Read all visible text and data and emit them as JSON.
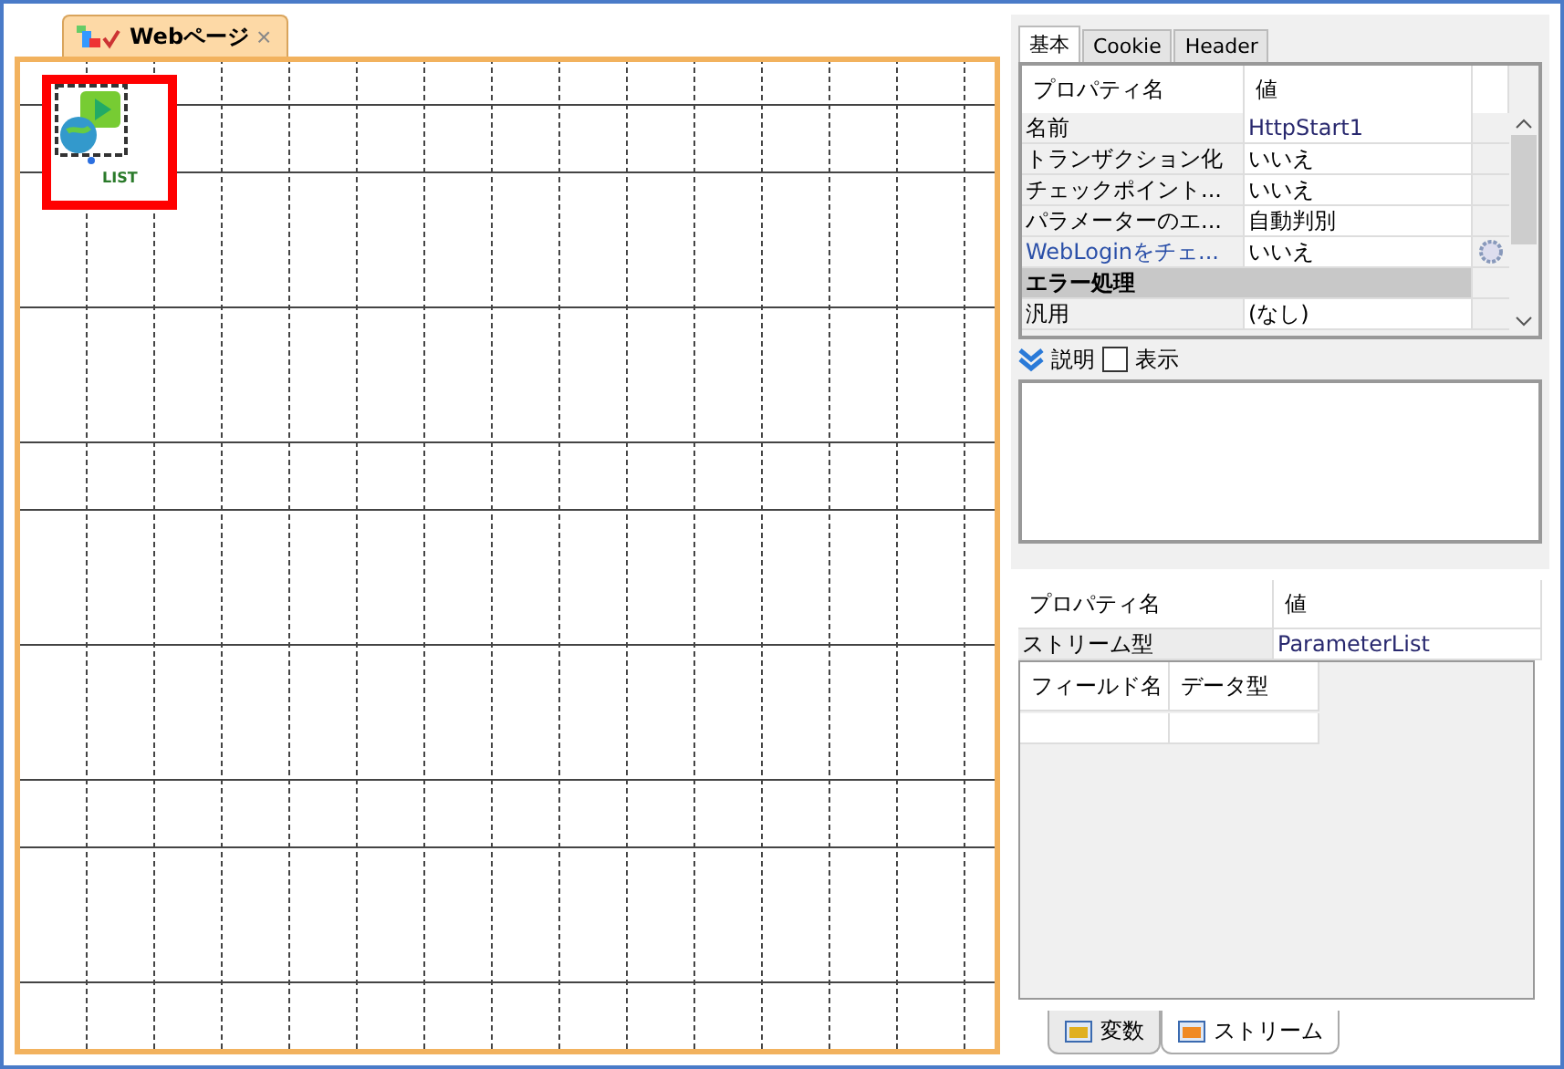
{
  "editor_tab": {
    "label": "Webページ",
    "close": "×"
  },
  "canvas": {
    "node": {
      "label": "LIST",
      "selected": true
    }
  },
  "property_tabs": [
    {
      "label": "基本",
      "selected": true
    },
    {
      "label": "Cookie",
      "selected": false
    },
    {
      "label": "Header",
      "selected": false
    }
  ],
  "property_grid": {
    "columns": [
      "プロパティ名",
      "値"
    ],
    "rows": [
      {
        "kind": "property",
        "name": "名前",
        "value": "HttpStart1",
        "has_button": false
      },
      {
        "kind": "property",
        "name": "トランザクション化",
        "value": "いいえ",
        "has_button": false
      },
      {
        "kind": "property",
        "name": "チェックポイント...",
        "value": "いいえ",
        "has_button": false
      },
      {
        "kind": "property",
        "name": "パラメーターのエ...",
        "value": "自動判別",
        "has_button": false
      },
      {
        "kind": "property",
        "name": "WebLoginをチェ...",
        "value": "いいえ",
        "has_button": true
      },
      {
        "kind": "category",
        "name": "エラー処理"
      },
      {
        "kind": "property",
        "name": "汎用",
        "value": "(なし)",
        "has_button": false
      }
    ]
  },
  "description": {
    "label": "説明",
    "show_label": "表示",
    "checked": false
  },
  "stream": {
    "columns": [
      "プロパティ名",
      "値"
    ],
    "row": {
      "name": "ストリーム型",
      "value": "ParameterList"
    },
    "fields": {
      "columns": [
        "フィールド名",
        "データ型"
      ]
    }
  },
  "bottom_tabs": [
    {
      "label": "変数",
      "selected": false
    },
    {
      "label": "ストリーム",
      "selected": true
    }
  ]
}
